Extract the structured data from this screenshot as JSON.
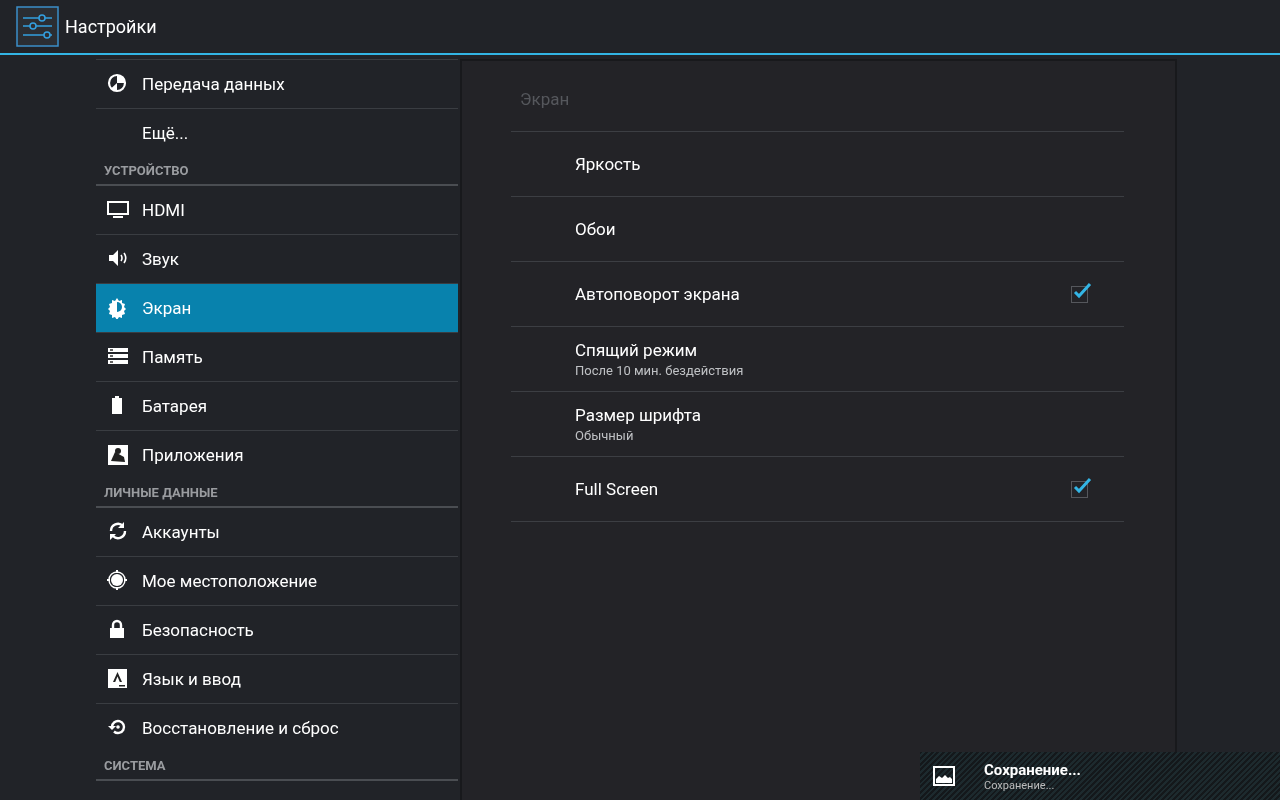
{
  "action_bar": {
    "title": "Настройки"
  },
  "sidebar": {
    "items": [
      {
        "kind": "item",
        "label": "Передача данных",
        "selected": false
      },
      {
        "kind": "item",
        "label": "Ещё...",
        "selected": false
      },
      {
        "kind": "header",
        "label": "УСТРОЙСТВО"
      },
      {
        "kind": "item",
        "label": "HDMI",
        "selected": false
      },
      {
        "kind": "item",
        "label": "Звук",
        "selected": false
      },
      {
        "kind": "item",
        "label": "Экран",
        "selected": true
      },
      {
        "kind": "item",
        "label": "Память",
        "selected": false
      },
      {
        "kind": "item",
        "label": "Батарея",
        "selected": false
      },
      {
        "kind": "item",
        "label": "Приложения",
        "selected": false
      },
      {
        "kind": "header",
        "label": "ЛИЧНЫЕ ДАННЫЕ"
      },
      {
        "kind": "item",
        "label": "Аккаунты",
        "selected": false
      },
      {
        "kind": "item",
        "label": "Мое местоположение",
        "selected": false
      },
      {
        "kind": "item",
        "label": "Безопасность",
        "selected": false
      },
      {
        "kind": "item",
        "label": "Язык и ввод",
        "selected": false
      },
      {
        "kind": "item",
        "label": "Восстановление и сброс",
        "selected": false
      },
      {
        "kind": "header",
        "label": "СИСТЕМА"
      }
    ]
  },
  "detail": {
    "title": "Экран",
    "settings": [
      {
        "kind": "plain",
        "title": "Яркость"
      },
      {
        "kind": "plain",
        "title": "Обои"
      },
      {
        "kind": "checkbox",
        "title": "Автоповорот экрана",
        "checked": true
      },
      {
        "kind": "plain",
        "title": "Спящий режим",
        "summary": "После 10 мин. бездействия"
      },
      {
        "kind": "plain",
        "title": "Размер шрифта",
        "summary": "Обычный"
      },
      {
        "kind": "checkbox",
        "title": "Full Screen",
        "checked": true
      }
    ]
  },
  "notification": {
    "title": "Сохранение...",
    "text": "Сохранение..."
  }
}
